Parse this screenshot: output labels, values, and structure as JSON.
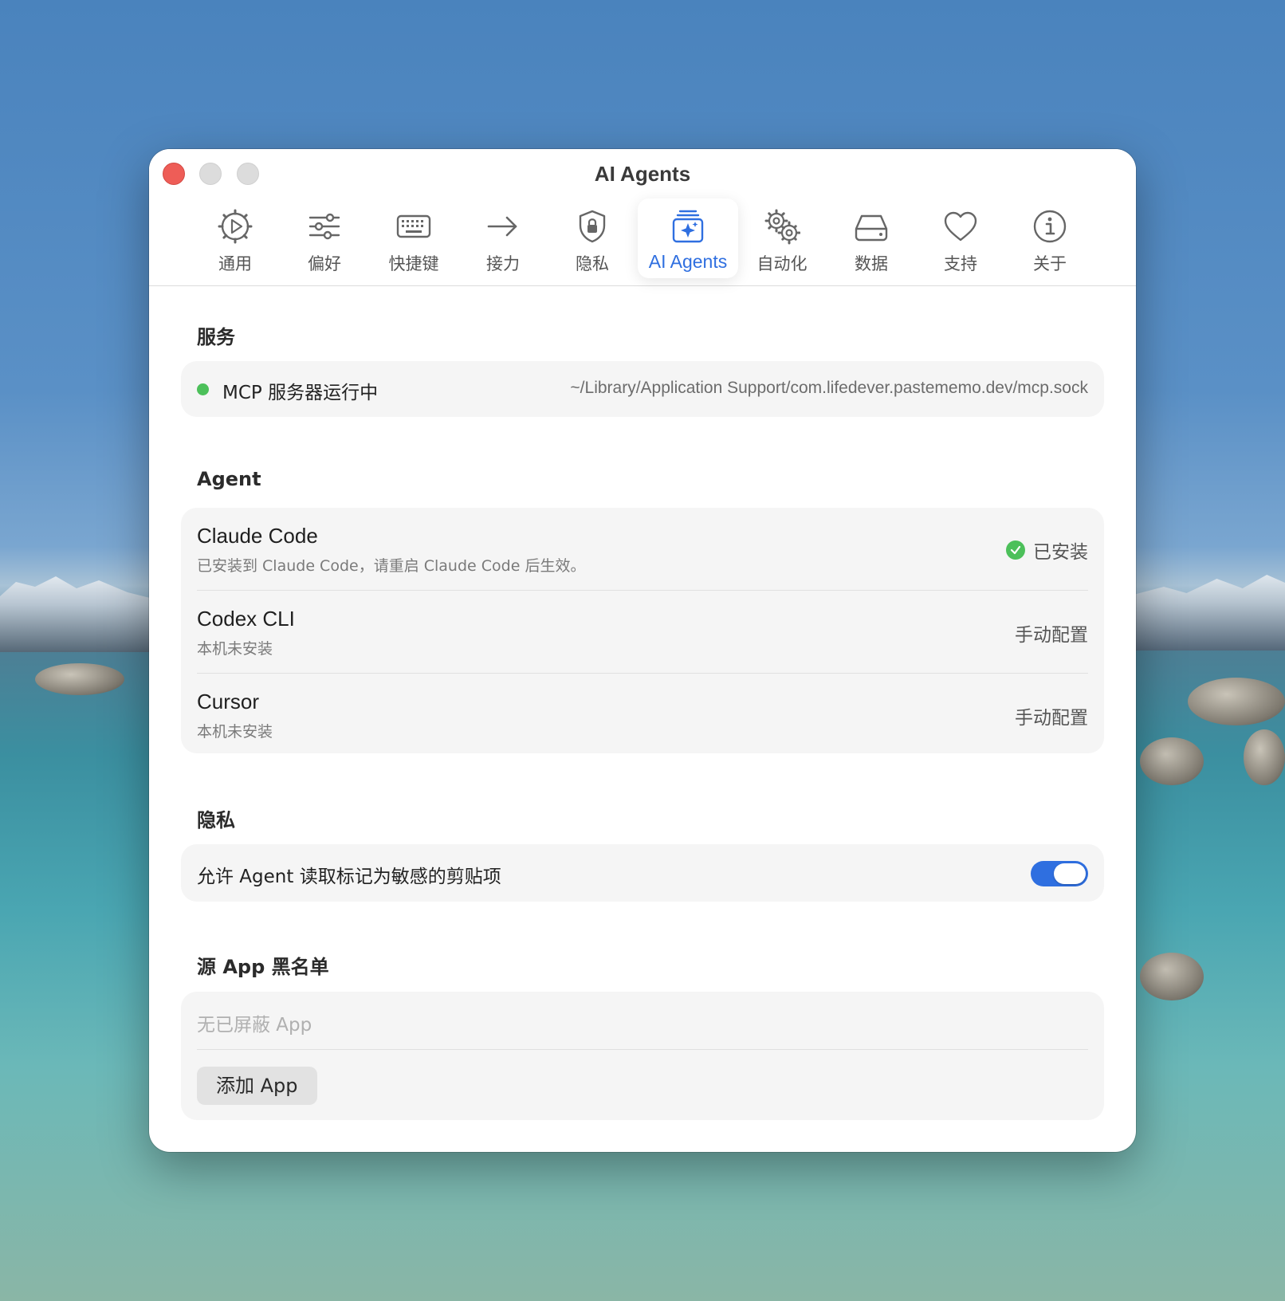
{
  "window": {
    "title": "AI Agents"
  },
  "tabs": [
    {
      "label": "通用",
      "icon": "gear-play-icon"
    },
    {
      "label": "偏好",
      "icon": "sliders-icon"
    },
    {
      "label": "快捷键",
      "icon": "keyboard-icon"
    },
    {
      "label": "接力",
      "icon": "arrow-right-icon"
    },
    {
      "label": "隐私",
      "icon": "shield-lock-icon"
    },
    {
      "label": "AI Agents",
      "icon": "sparkle-stack-icon",
      "active": true
    },
    {
      "label": "自动化",
      "icon": "gears-icon"
    },
    {
      "label": "数据",
      "icon": "drive-icon"
    },
    {
      "label": "支持",
      "icon": "heart-icon"
    },
    {
      "label": "关于",
      "icon": "info-icon"
    }
  ],
  "services": {
    "title": "服务",
    "status_label": "MCP 服务器运行中",
    "socket_path": "~/Library/Application Support/com.lifedever.pastememo.dev/mcp.sock"
  },
  "agents": {
    "title": "Agent",
    "items": [
      {
        "name": "Claude Code",
        "desc": "已安装到 Claude Code，请重启 Claude Code 后生效。",
        "status": "已安装"
      },
      {
        "name": "Codex CLI",
        "desc": "本机未安装",
        "status": "手动配置"
      },
      {
        "name": "Cursor",
        "desc": "本机未安装",
        "status": "手动配置"
      }
    ]
  },
  "privacy": {
    "title": "隐私",
    "toggle_label": "允许 Agent 读取标记为敏感的剪贴项",
    "toggle_on": true
  },
  "blacklist": {
    "title": "源 App 黑名单",
    "empty_text": "无已屏蔽 App",
    "add_button": "添加 App"
  },
  "colors": {
    "accent": "#2f6fe0",
    "success": "#4cc05a",
    "close": "#ee5d57"
  }
}
